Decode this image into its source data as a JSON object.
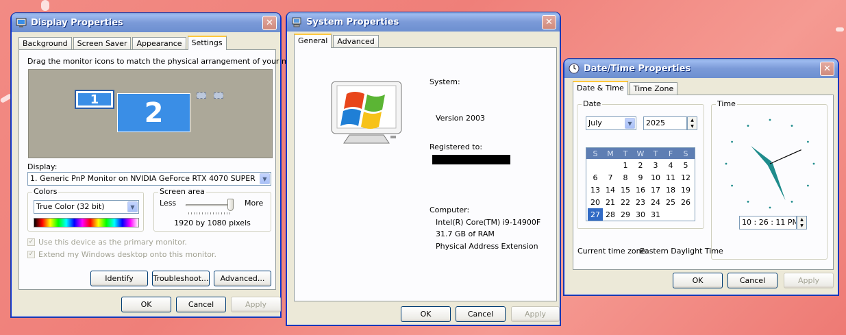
{
  "display": {
    "title": "Display Properties",
    "tabs": [
      "Background",
      "Screen Saver",
      "Appearance",
      "Settings"
    ],
    "active_tab": "Settings",
    "instruction": "Drag the monitor icons to match the physical arrangement of your monitors.",
    "monitor1": "1",
    "monitor2": "2",
    "display_label": "Display:",
    "display_value": "1. Generic PnP Monitor on NVIDIA GeForce RTX 4070 SUPER",
    "colors_label": "Colors",
    "colors_value": "True Color (32 bit)",
    "screen_area_label": "Screen area",
    "less": "Less",
    "more": "More",
    "resolution": "1920 by 1080 pixels",
    "slider_fraction": 0.93,
    "primary_label": "Use this device as the primary monitor.",
    "extend_label": "Extend my Windows desktop onto this monitor.",
    "identify": "Identify",
    "troubleshoot": "Troubleshoot...",
    "advanced": "Advanced...",
    "ok": "OK",
    "cancel": "Cancel",
    "apply": "Apply"
  },
  "system": {
    "title": "System Properties",
    "tabs": [
      "General",
      "Advanced"
    ],
    "active_tab": "General",
    "system_label": "System:",
    "version": "Version 2003",
    "registered_label": "Registered to:",
    "computer_label": "Computer:",
    "cpu": "Intel(R) Core(TM) i9-14900F",
    "ram": "31.7 GB of RAM",
    "pae": "Physical Address Extension",
    "ok": "OK",
    "cancel": "Cancel",
    "apply": "Apply"
  },
  "datetime": {
    "title": "Date/Time Properties",
    "tabs": [
      "Date & Time",
      "Time Zone"
    ],
    "active_tab": "Date & Time",
    "date_label": "Date",
    "time_label": "Time",
    "month": "July",
    "year": "2025",
    "weekdays": [
      "S",
      "M",
      "T",
      "W",
      "T",
      "F",
      "S"
    ],
    "weeks": [
      [
        "",
        "",
        "1",
        "2",
        "3",
        "4",
        "5"
      ],
      [
        "6",
        "7",
        "8",
        "9",
        "10",
        "11",
        "12"
      ],
      [
        "13",
        "14",
        "15",
        "16",
        "17",
        "18",
        "19"
      ],
      [
        "20",
        "21",
        "22",
        "23",
        "24",
        "25",
        "26"
      ],
      [
        "27",
        "28",
        "29",
        "30",
        "31",
        "",
        ""
      ]
    ],
    "selected_day": "27",
    "time": "10 : 26 : 11 PM",
    "clock": {
      "hour": 10,
      "minute": 26,
      "second": 11
    },
    "tz_label": "Current time zone:",
    "tz_value": "Eastern Daylight Time",
    "ok": "OK",
    "cancel": "Cancel",
    "apply": "Apply"
  },
  "colors": {
    "titlebar_active": "#0a58d6",
    "dialog_face": "#ece9d8",
    "monitor_blue": "#3a8ee6",
    "calendar_header": "#5e7eb3",
    "selection": "#316ac5",
    "clock_hand": "#1f8c8c"
  }
}
